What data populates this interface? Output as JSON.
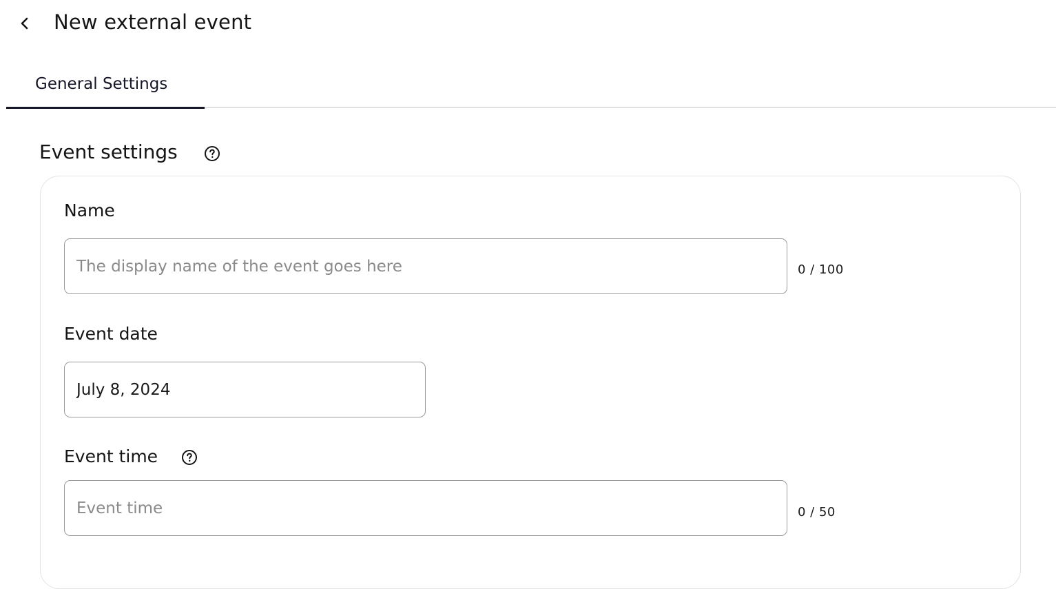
{
  "header": {
    "title": "New external event",
    "back_icon": "chevron-left-icon"
  },
  "tabs": [
    {
      "label": "General Settings",
      "active": true
    }
  ],
  "section": {
    "title": "Event settings",
    "help_icon": "help-circle-icon"
  },
  "fields": {
    "name": {
      "label": "Name",
      "value": "",
      "placeholder": "The display name of the event goes here",
      "counter": "0 / 100"
    },
    "date": {
      "label": "Event date",
      "value": "July 8, 2024",
      "placeholder": ""
    },
    "time": {
      "label": "Event time",
      "help_icon": "help-circle-icon",
      "value": "",
      "placeholder": "Event time",
      "counter": "0 / 50"
    }
  },
  "colors": {
    "text": "#141414",
    "tab_accent": "#17172a",
    "input_border": "#9a9a9a",
    "card_border": "#e3e3e3",
    "placeholder": "#8a8a8a"
  }
}
